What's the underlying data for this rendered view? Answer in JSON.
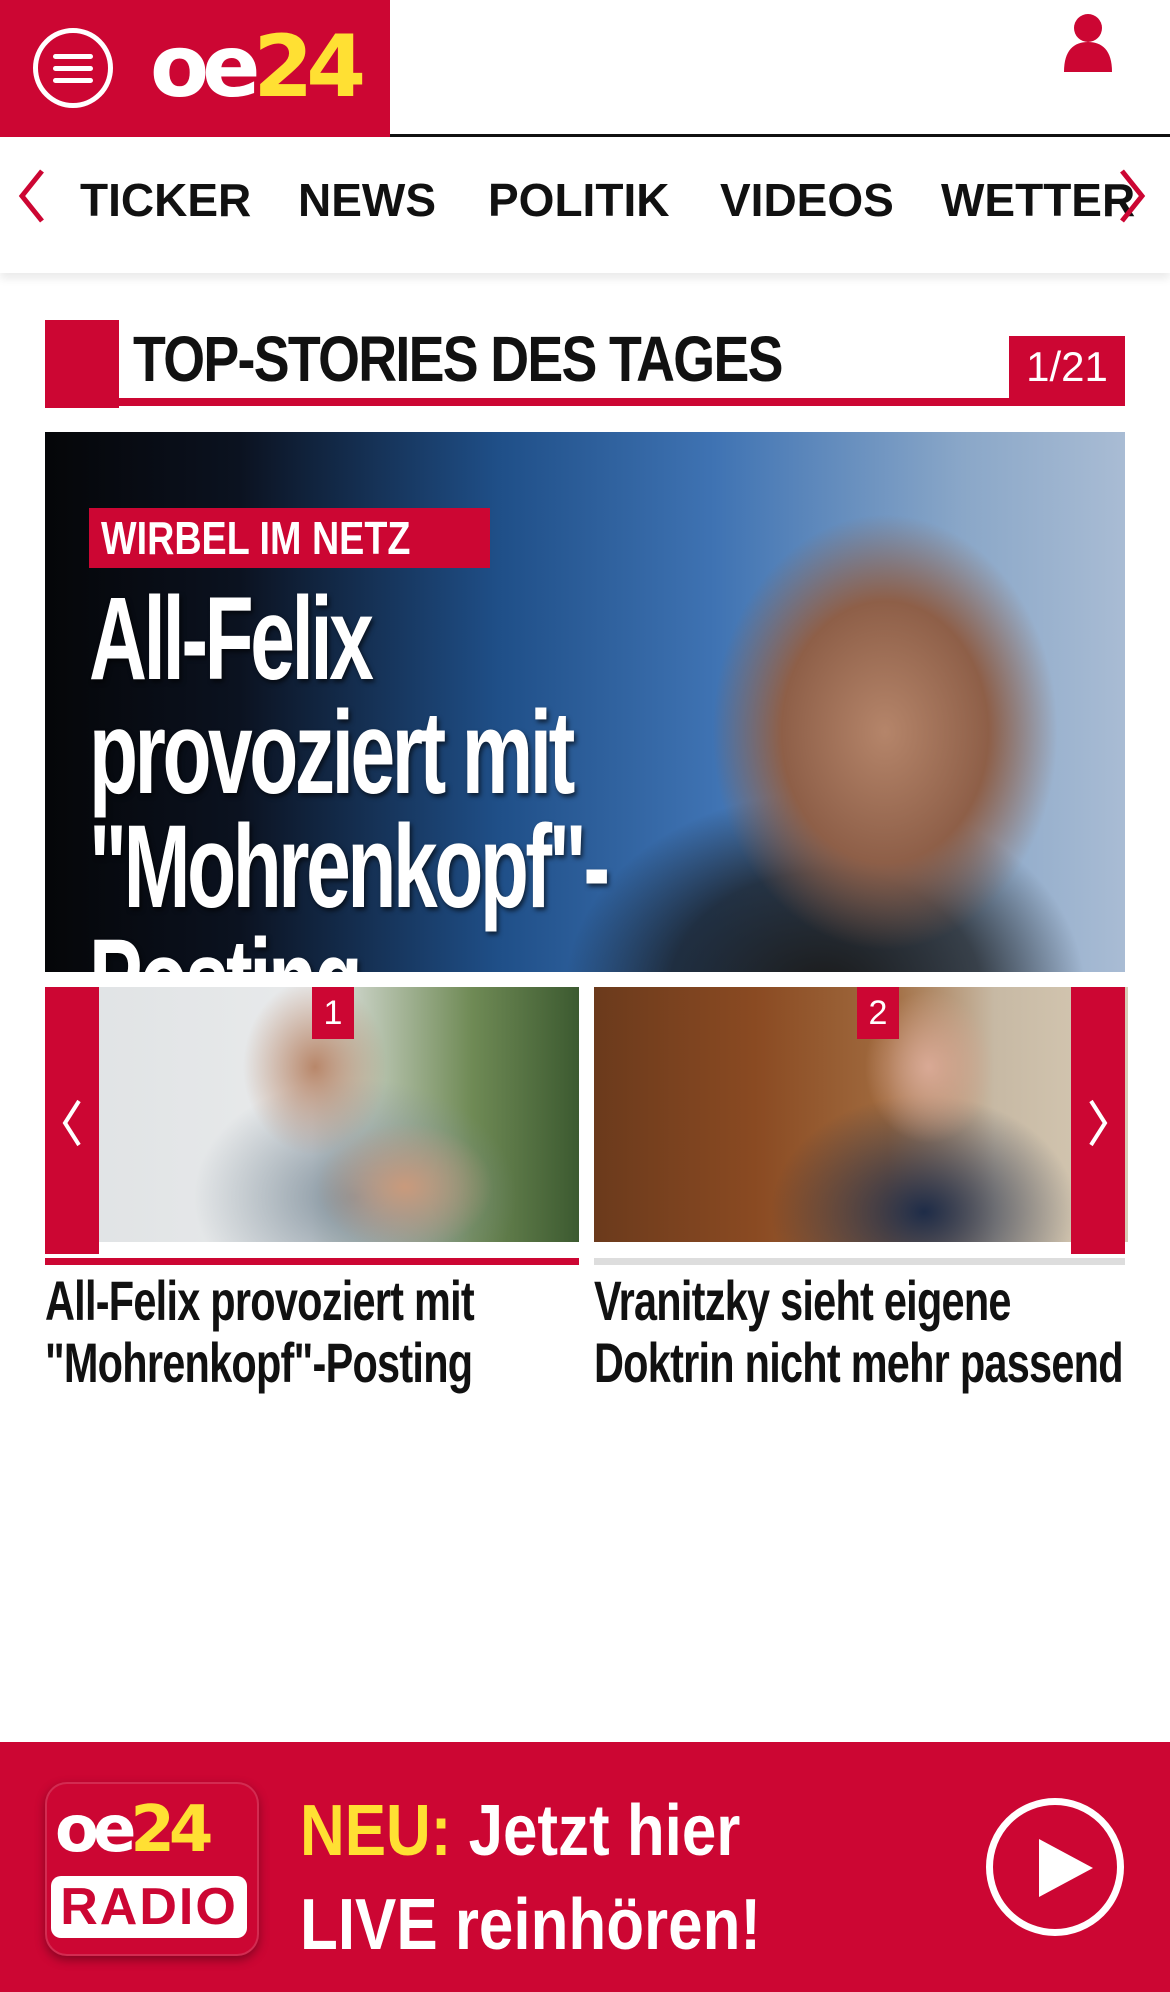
{
  "header": {
    "logo_oe": "oe",
    "logo_24": "24",
    "menu_icon": "hamburger-menu-icon",
    "user_icon": "user-icon",
    "brand_color": "#cc0633",
    "logo_accent_color": "#ffe033"
  },
  "nav": {
    "items": [
      "TICKER",
      "NEWS",
      "POLITIK",
      "VIDEOS",
      "WETTER"
    ],
    "prev_icon": "chevron-left-icon",
    "next_icon": "chevron-right-icon"
  },
  "section": {
    "title": "TOP-STORIES DES TAGES",
    "counter": "1/21"
  },
  "hero": {
    "kicker": "WIRBEL IM NETZ",
    "title_lines": [
      "All-Felix",
      "provoziert mit",
      "\"Mohrenkopf\"-Posting"
    ]
  },
  "cards": [
    {
      "badge": "1",
      "title_lines": [
        "All-Felix provoziert mit",
        "\"Mohrenkopf\"-Posting"
      ]
    },
    {
      "badge": "2",
      "title_lines": [
        "Vranitzky sieht eigene",
        "Doktrin nicht mehr passend"
      ]
    }
  ],
  "radio": {
    "logo_oe": "oe",
    "logo_24": "24",
    "logo_radio": "RADIO",
    "neu": "NEU:",
    "line1_rest": " Jetzt hier",
    "line2": "LIVE reinhören!",
    "play_icon": "play-icon"
  }
}
